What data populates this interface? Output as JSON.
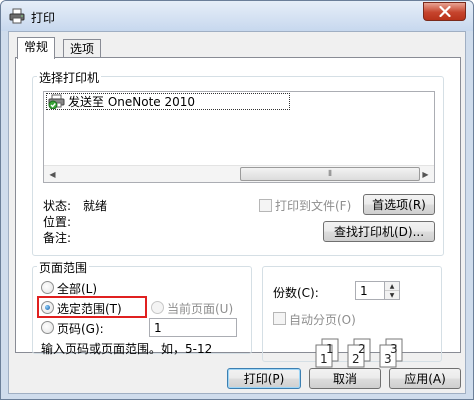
{
  "window": {
    "title": "打印"
  },
  "tabs": [
    {
      "label": "常规"
    },
    {
      "label": "选项"
    }
  ],
  "printer_group": {
    "legend": "选择打印机",
    "selected_printer": "发送至 OneNote 2010",
    "status_label": "状态:",
    "status_value": "就绪",
    "location_label": "位置:",
    "comment_label": "备注:",
    "print_to_file": "打印到文件(F)",
    "preferences_button": "首选项(R)",
    "find_printer_button": "查找打印机(D)..."
  },
  "range_group": {
    "legend": "页面范围",
    "all": "全部(L)",
    "selection": "选定范围(T)",
    "current_page": "当前页面(U)",
    "pages": "页码(G):",
    "pages_value": "1",
    "hint": "输入页码或页面范围。如，5-12"
  },
  "copies_group": {
    "copies_label": "份数(C):",
    "copies_value": "1",
    "collate": "自动分页(O)",
    "collate_digits": [
      "1",
      "1",
      "2",
      "2",
      "3",
      "3"
    ]
  },
  "buttons": {
    "print": "打印(P)",
    "cancel": "取消",
    "apply": "应用(A)"
  },
  "colors": {
    "highlight": "#e02020",
    "accent": "#3c7fb1"
  }
}
